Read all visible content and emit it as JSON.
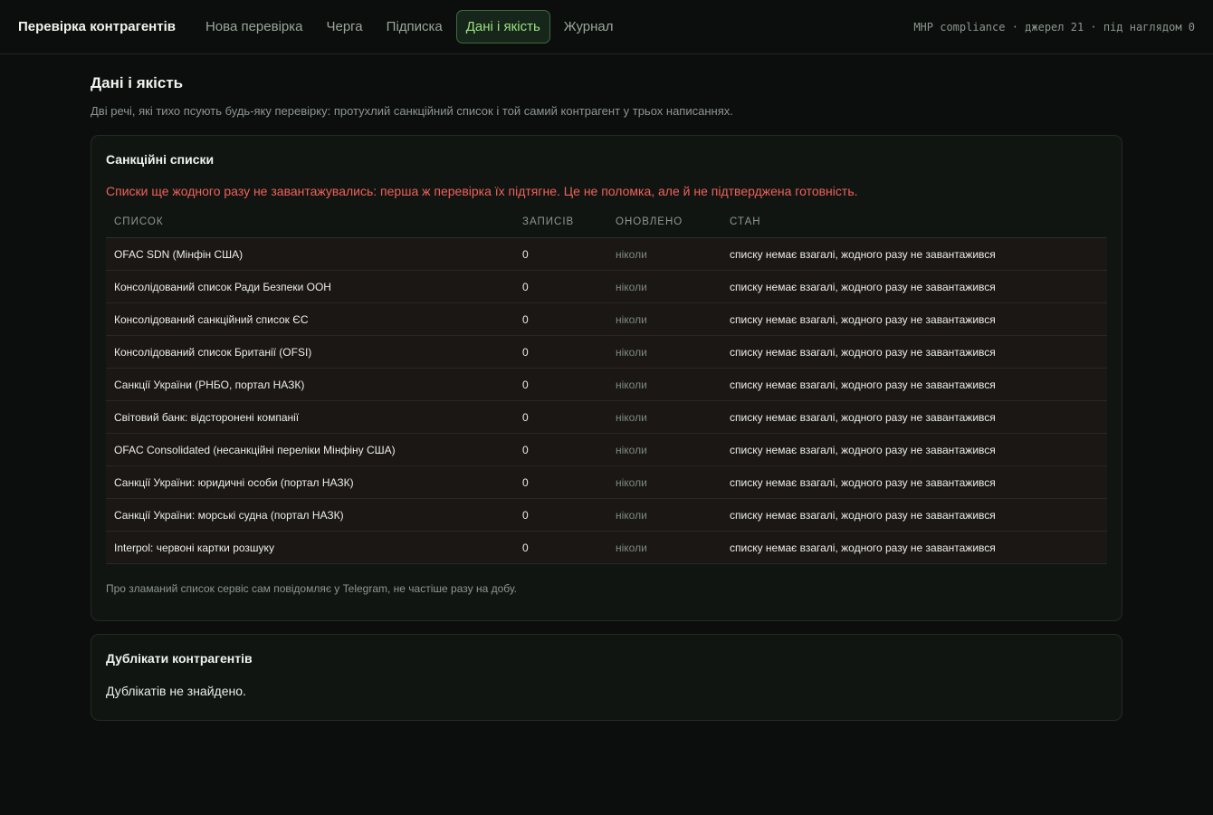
{
  "header": {
    "brand": "Перевірка контрагентів",
    "nav": [
      {
        "label": "Нова перевірка",
        "active": false
      },
      {
        "label": "Черга",
        "active": false
      },
      {
        "label": "Підписка",
        "active": false
      },
      {
        "label": "Дані і якість",
        "active": true
      },
      {
        "label": "Журнал",
        "active": false
      }
    ],
    "status": "MHP compliance · джерел 21 · під наглядом 0"
  },
  "page": {
    "title": "Дані і якість",
    "subtitle": "Дві речі, які тихо псують будь-яку перевірку: протухлий санкційний список і той самий контрагент у трьох написаннях."
  },
  "sanctions": {
    "title": "Санкційні списки",
    "warning": "Списки ще жодного разу не завантажувались: перша ж перевірка їх підтягне. Це не поломка, але й не підтверджена готовність.",
    "columns": [
      "Список",
      "Записів",
      "Оновлено",
      "Стан"
    ],
    "rows": [
      {
        "name": "OFAC SDN (Мінфін США)",
        "records": "0",
        "updated": "ніколи",
        "state": "списку немає взагалі, жодного разу не завантажився"
      },
      {
        "name": "Консолідований список Ради Безпеки ООН",
        "records": "0",
        "updated": "ніколи",
        "state": "списку немає взагалі, жодного разу не завантажився"
      },
      {
        "name": "Консолідований санкційний список ЄС",
        "records": "0",
        "updated": "ніколи",
        "state": "списку немає взагалі, жодного разу не завантажився"
      },
      {
        "name": "Консолідований список Британії (OFSI)",
        "records": "0",
        "updated": "ніколи",
        "state": "списку немає взагалі, жодного разу не завантажився"
      },
      {
        "name": "Санкції України (РНБО, портал НАЗК)",
        "records": "0",
        "updated": "ніколи",
        "state": "списку немає взагалі, жодного разу не завантажився"
      },
      {
        "name": "Світовий банк: відсторонені компанії",
        "records": "0",
        "updated": "ніколи",
        "state": "списку немає взагалі, жодного разу не завантажився"
      },
      {
        "name": "OFAC Consolidated (несанкційні переліки Мінфіну США)",
        "records": "0",
        "updated": "ніколи",
        "state": "списку немає взагалі, жодного разу не завантажився"
      },
      {
        "name": "Санкції України: юридичні особи (портал НАЗК)",
        "records": "0",
        "updated": "ніколи",
        "state": "списку немає взагалі, жодного разу не завантажився"
      },
      {
        "name": "Санкції України: морські судна (портал НАЗК)",
        "records": "0",
        "updated": "ніколи",
        "state": "списку немає взагалі, жодного разу не завантажився"
      },
      {
        "name": "Interpol: червоні картки розшуку",
        "records": "0",
        "updated": "ніколи",
        "state": "списку немає взагалі, жодного разу не завантажився"
      }
    ],
    "footnote": "Про зламаний список сервіс сам повідомляє у Telegram, не частіше разу на добу."
  },
  "duplicates": {
    "title": "Дублікати контрагентів",
    "text": "Дублікатів не знайдено."
  }
}
